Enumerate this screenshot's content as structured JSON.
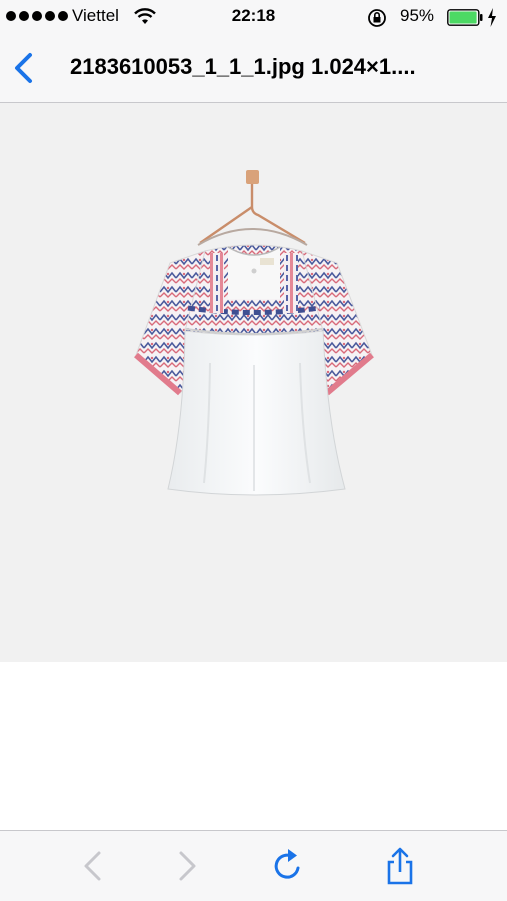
{
  "status_bar": {
    "carrier": "Viettel",
    "time": "22:18",
    "battery_percent": "95%",
    "battery_level": 0.95,
    "icons": [
      "signal-dots-icon",
      "wifi-icon",
      "rotation-lock-icon",
      "battery-icon",
      "charging-bolt-icon"
    ]
  },
  "nav": {
    "title": "2183610053_1_1_1.jpg 1.024×1....",
    "back_icon": "chevron-left-icon"
  },
  "toolbar": {
    "icons": [
      "back-arrow-icon",
      "forward-arrow-icon",
      "reload-icon",
      "share-icon"
    ]
  },
  "colors": {
    "accent": "#1a73e8",
    "disabled": "#c7c7cc",
    "battery_green": "#4cd964"
  }
}
